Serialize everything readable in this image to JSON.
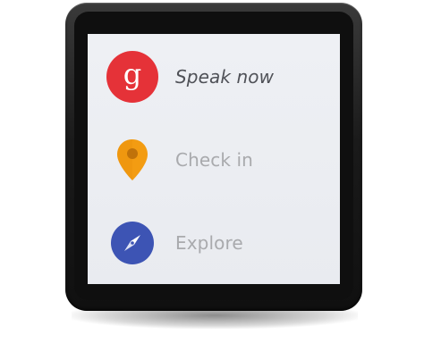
{
  "menu": {
    "items": [
      {
        "label": "Speak now",
        "icon": "google-g-icon",
        "color": "#e53238"
      },
      {
        "label": "Check in",
        "icon": "location-pin-icon",
        "color": "#f39c12"
      },
      {
        "label": "Explore",
        "icon": "compass-icon",
        "color": "#3d54b4"
      }
    ],
    "google_glyph": "g"
  }
}
